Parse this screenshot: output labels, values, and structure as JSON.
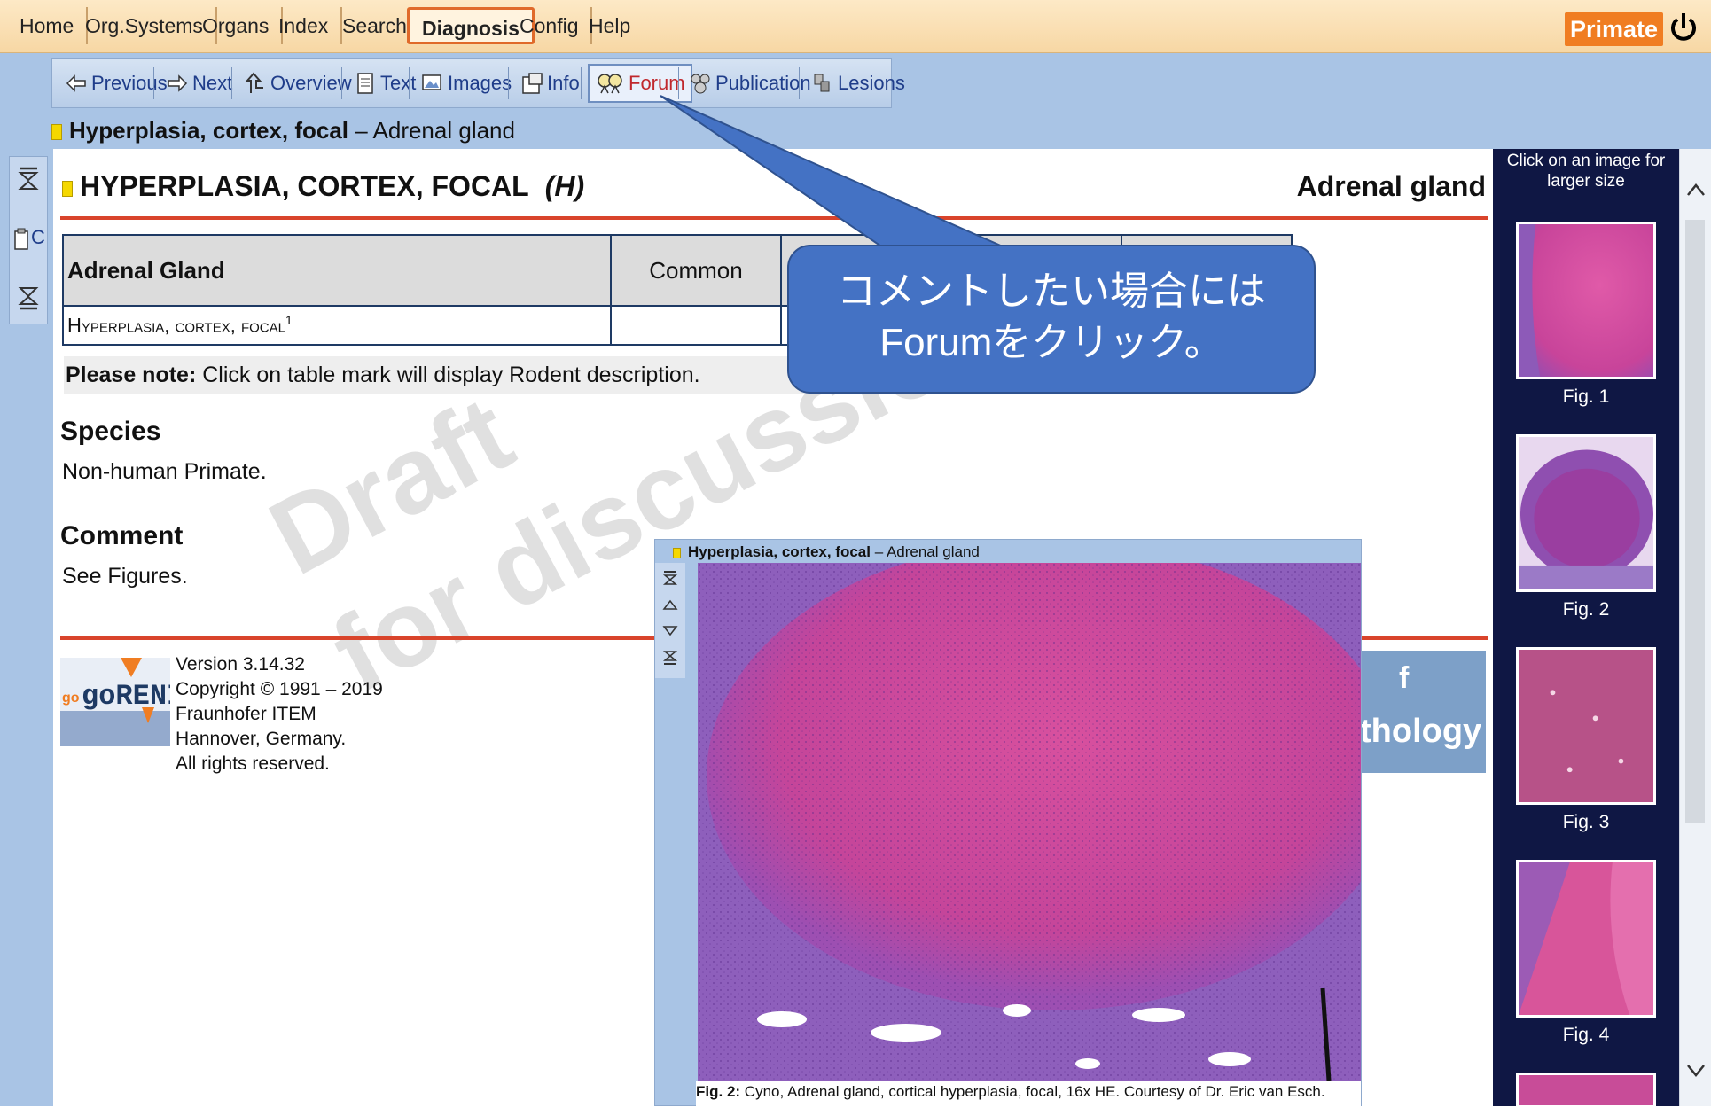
{
  "topnav": {
    "tabs": [
      "Home",
      "Org.Systems",
      "Organs",
      "Index",
      "Search",
      "Diagnosis",
      "Config",
      "Help"
    ],
    "active": "Diagnosis",
    "badge": "Primate",
    "power_icon": "power-icon"
  },
  "toolbar": {
    "buttons": [
      "Previous",
      "Next",
      "Overview",
      "Text",
      "Images",
      "Info",
      "Forum",
      "Publication",
      "Lesions"
    ],
    "active": "Forum"
  },
  "breadcrumb": {
    "lesion": "Hyperplasia, cortex, focal",
    "sep": " – ",
    "organ": "Adrenal gland"
  },
  "main": {
    "title": "HYPERPLASIA, CORTEX, FOCAL",
    "title_code": "(H)",
    "organ": "Adrenal gland",
    "table": {
      "headers": [
        "Adrenal Gland",
        "Common",
        "",
        ""
      ],
      "row": "Hyperplasia, cortex, focal",
      "row_sup": "1"
    },
    "note_label": "Please note:",
    "note_text": " Click on table mark will display Rodent description.",
    "species_heading": "Species",
    "species_text": "Non-human Primate.",
    "comment_heading": "Comment",
    "comment_text": "See Figures.",
    "watermark_line1": "Draft",
    "watermark_line2": "for discussion",
    "footer": {
      "version": "Version 3.14.32",
      "copyright": "Copyright © 1991 – 2019",
      "org": "Fraunhofer ITEM",
      "city": "Hannover, Germany.",
      "rights": "All rights reserved.",
      "logo_text": "goRENI"
    },
    "banner_text": "thology",
    "banner_text2": "f"
  },
  "rightpanel": {
    "caption": "Click on an image for larger size",
    "figs": [
      "Fig. 1",
      "Fig. 2",
      "Fig. 3",
      "Fig. 4"
    ]
  },
  "popup": {
    "title_bold": "Hyperplasia, cortex, focal",
    "title_rest": " – Adrenal gland",
    "caption_bold": "Fig. 2:",
    "caption_rest": " Cyno, Adrenal gland, cortical hyperplasia, focal, 16x HE. Courtesy of Dr. Eric van Esch."
  },
  "callout": {
    "line1": "コメントしたい場合には",
    "line2": "Forumをクリック。"
  },
  "colors": {
    "accent": "#f07d22",
    "nav_blue": "#a9c4e5",
    "panel_dark": "#0f1744",
    "callout": "#4472c4",
    "rule": "#d9442b"
  }
}
